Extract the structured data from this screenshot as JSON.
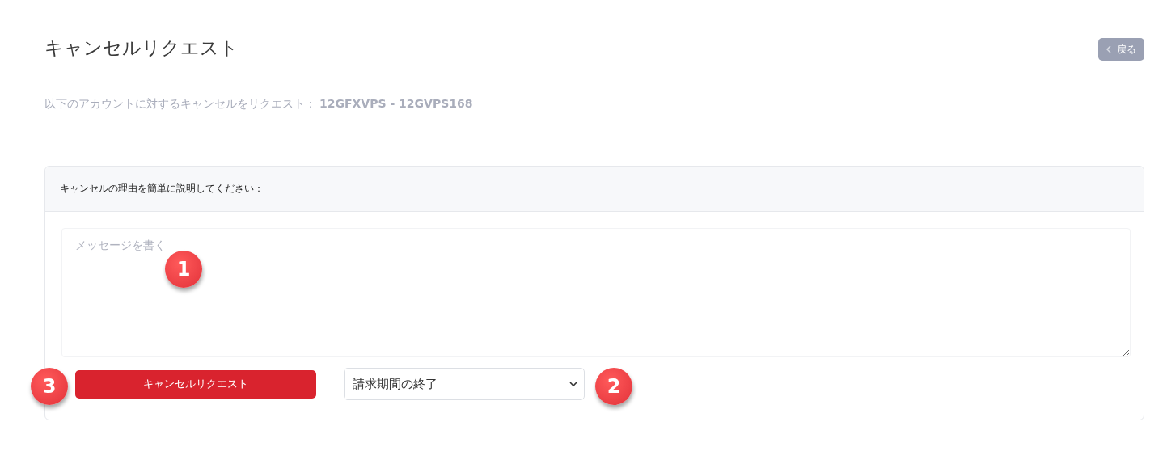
{
  "title": "キャンセルリクエスト",
  "back_button": {
    "label": "戻る"
  },
  "subtitle": {
    "text": "以下のアカウントに対するキャンセルをリクエスト：",
    "account": "12GFXVPS - 12GVPS168"
  },
  "form": {
    "header": "キャンセルの理由を簡単に説明してください：",
    "message_field": {
      "placeholder": "メッセージを書く"
    },
    "submit_button": "キャンセルリクエスト",
    "timing_select": {
      "value": "請求期間の終了"
    }
  },
  "annotations": [
    {
      "label": "1"
    },
    {
      "label": "2"
    },
    {
      "label": "3"
    }
  ]
}
